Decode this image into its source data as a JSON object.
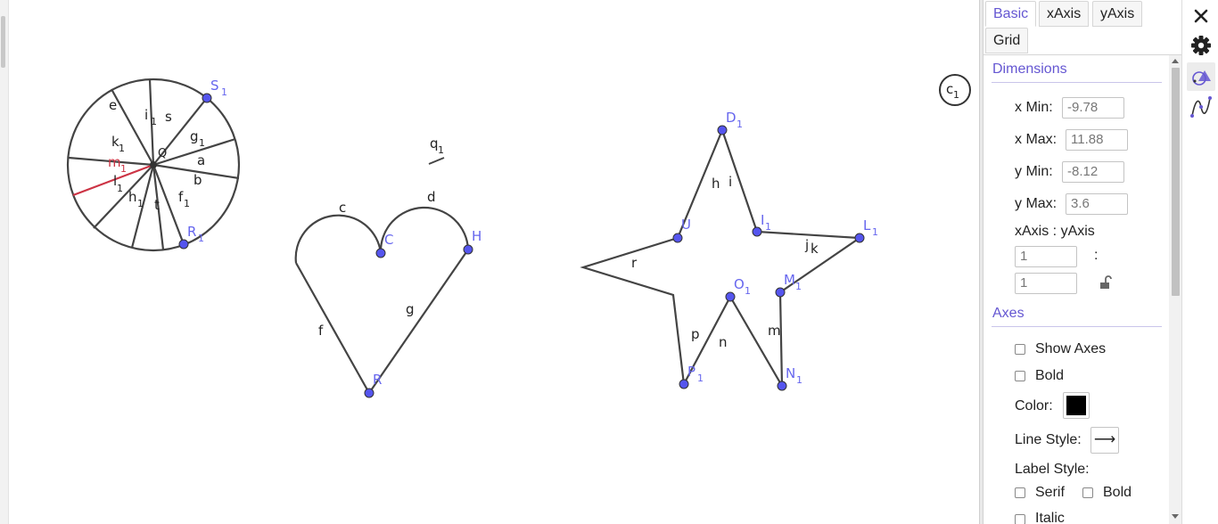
{
  "canvas": {
    "labels": {
      "circle_lines": [
        "e",
        "i",
        "1",
        "s",
        "k",
        "1",
        "g",
        "1",
        "a",
        "m",
        "1",
        "b",
        "l",
        "1",
        "h",
        "1",
        "t",
        "f",
        "1"
      ],
      "q": [
        "q",
        "1"
      ],
      "heart": [
        "c",
        "d",
        "f",
        "g"
      ],
      "star": [
        "h",
        "i",
        "j",
        "k",
        "p",
        "n",
        "m"
      ]
    },
    "points": {
      "S1": [
        "S",
        "1"
      ],
      "R1": [
        "R",
        "1"
      ],
      "Q": "Q",
      "C": "C",
      "H": "H",
      "R": "R",
      "D1": [
        "D",
        "1"
      ],
      "U": "U",
      "I1": [
        "I",
        "1"
      ],
      "L1": [
        "L",
        "1"
      ],
      "O1": [
        "O",
        "1"
      ],
      "M1": [
        "M",
        "1"
      ],
      "P1": [
        "P",
        "1"
      ],
      "N1": [
        "N",
        "1"
      ],
      "c1": [
        "c",
        "1"
      ],
      "r": "r"
    },
    "colors": {
      "line": "#444444",
      "point_fill": "#5555ee",
      "point_label": "#6666ee",
      "highlight_line": "#cc3344"
    }
  },
  "panel": {
    "tabs": [
      {
        "label": "Basic",
        "active": true
      },
      {
        "label": "xAxis",
        "active": false
      },
      {
        "label": "yAxis",
        "active": false
      },
      {
        "label": "Grid",
        "active": false
      }
    ],
    "dimensions": {
      "title": "Dimensions",
      "xmin_label": "x Min:",
      "xmin_value": "-9.78",
      "xmax_label": "x Max:",
      "xmax_value": "11.88",
      "ymin_label": "y Min:",
      "ymin_value": "-8.12",
      "ymax_label": "y Max:",
      "ymax_value": "3.6",
      "ratio_label": "xAxis : yAxis",
      "ratio_x": "1",
      "ratio_colon": ":",
      "ratio_y": "1"
    },
    "axes": {
      "title": "Axes",
      "show_axes_label": "Show Axes",
      "bold_label": "Bold",
      "color_label": "Color:",
      "color_value": "#000000",
      "line_style_label": "Line Style:",
      "line_style_glyph": "⟶",
      "label_style_label": "Label Style:",
      "serif_label": "Serif",
      "label_bold_label": "Bold",
      "italic_label": "Italic"
    }
  },
  "sidebar_icons": [
    "close-icon",
    "gear-icon",
    "graphics-view-icon",
    "algebra-graph-icon"
  ]
}
